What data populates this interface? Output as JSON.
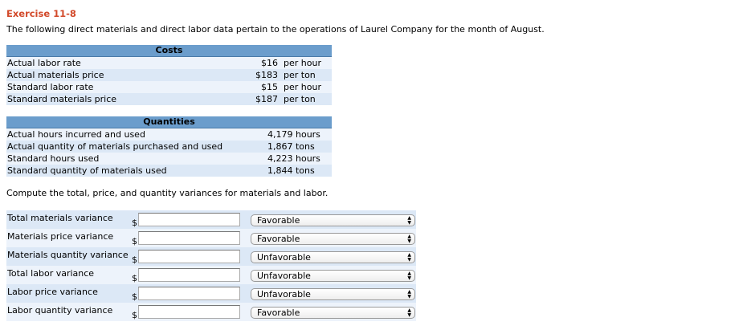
{
  "title": "Exercise 11-8",
  "intro": "The following direct materials and direct labor data pertain to the operations of Laurel Company for the month of August.",
  "costs": {
    "header": "Costs",
    "rows": [
      {
        "label": "Actual labor rate",
        "amount": "$16",
        "unit": "per hour"
      },
      {
        "label": "Actual materials price",
        "amount": "$183",
        "unit": "per ton"
      },
      {
        "label": "Standard labor rate",
        "amount": "$15",
        "unit": "per hour"
      },
      {
        "label": "Standard materials price",
        "amount": "$187",
        "unit": "per ton"
      }
    ]
  },
  "quantities": {
    "header": "Quantities",
    "rows": [
      {
        "label": "Actual hours incurred and used",
        "value": "4,179 hours"
      },
      {
        "label": "Actual quantity of materials purchased and used",
        "value": "1,867 tons"
      },
      {
        "label": "Standard hours used",
        "value": "4,223 hours"
      },
      {
        "label": "Standard quantity of materials used",
        "value": "1,844 tons"
      }
    ]
  },
  "instruction": "Compute the total, price, and quantity variances for materials and labor.",
  "answers": [
    {
      "label": "Total materials variance",
      "currency": "$",
      "value": "",
      "selection": "Favorable"
    },
    {
      "label": "Materials price variance",
      "currency": "$",
      "value": "",
      "selection": "Favorable"
    },
    {
      "label": "Materials quantity variance",
      "currency": "$",
      "value": "",
      "selection": "Unfavorable"
    },
    {
      "label": "Total labor variance",
      "currency": "$",
      "value": "",
      "selection": "Unfavorable"
    },
    {
      "label": "Labor price variance",
      "currency": "$",
      "value": "",
      "selection": "Unfavorable"
    },
    {
      "label": "Labor quantity variance",
      "currency": "$",
      "value": "",
      "selection": "Favorable"
    }
  ]
}
